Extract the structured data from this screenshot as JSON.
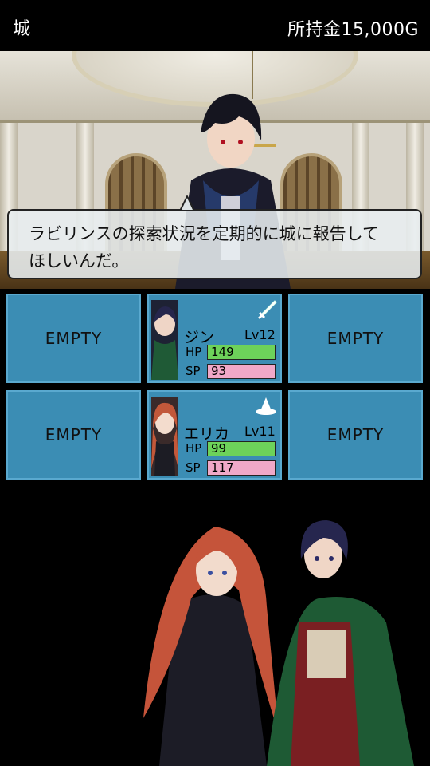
{
  "header": {
    "location": "城",
    "money": "所持金15,000G"
  },
  "scene": {
    "dialog_line1": "ラビリンスの探索状況を定期的に城に報告して",
    "dialog_line2": "ほしいんだ。"
  },
  "party": {
    "empty_label": "EMPTY",
    "members": [
      {
        "name": "ジン",
        "level": "Lv12",
        "hp_label": "HP",
        "hp": "149",
        "sp_label": "SP",
        "sp": "93",
        "class_icon": "sword-icon"
      },
      {
        "name": "エリカ",
        "level": "Lv11",
        "hp_label": "HP",
        "hp": "99",
        "sp_label": "SP",
        "sp": "117",
        "class_icon": "wizard-hat-icon"
      }
    ]
  },
  "colors": {
    "slot_bg": "#3b8db4",
    "hp_bar": "#6dd25a",
    "sp_bar": "#f0a8c8"
  }
}
